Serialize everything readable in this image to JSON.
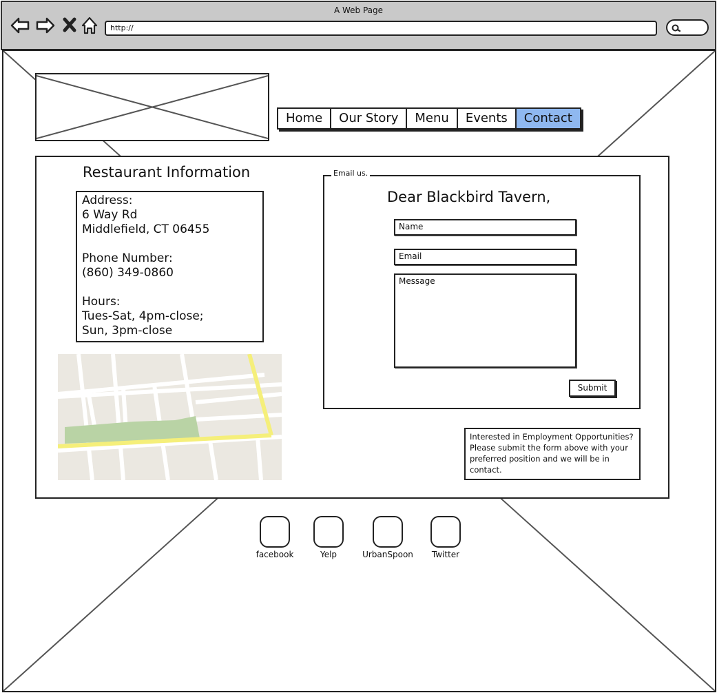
{
  "window": {
    "title": "A Web Page"
  },
  "browser": {
    "back_icon": "back-arrow-icon",
    "forward_icon": "forward-arrow-icon",
    "stop_icon": "close-x-icon",
    "home_icon": "home-icon",
    "url": "http://",
    "search_icon": "search-icon"
  },
  "nav": {
    "items": [
      {
        "label": "Home"
      },
      {
        "label": "Our Story"
      },
      {
        "label": "Menu"
      },
      {
        "label": "Events"
      },
      {
        "label": "Contact"
      }
    ],
    "active_index": 4,
    "active_color": "#8fb8f0"
  },
  "info": {
    "title": "Restaurant Information",
    "address_label": "Address:",
    "address_line1": "6 Way Rd",
    "address_line2": "Middlefield, CT 06455",
    "phone_label": "Phone Number:",
    "phone": "(860) 349-0860",
    "hours_label": "Hours:",
    "hours_line1": "Tues-Sat, 4pm-close;",
    "hours_line2": "Sun, 3pm-close"
  },
  "map": {
    "park_color": "#b9d3a5",
    "road_color": "#f5ef7a",
    "land_color": "#ebe8e1"
  },
  "email_form": {
    "legend": "Email us.",
    "salutation": "Dear Blackbird Tavern,",
    "name_placeholder": "Name",
    "email_placeholder": "Email",
    "message_placeholder": "Message",
    "submit_label": "Submit"
  },
  "employment": {
    "text": "Interested in Employment Opportunities? Please submit the form above with your preferred position and we will be in contact."
  },
  "social": [
    {
      "label": "facebook"
    },
    {
      "label": "Yelp"
    },
    {
      "label": "UrbanSpoon"
    },
    {
      "label": "Twitter"
    }
  ]
}
